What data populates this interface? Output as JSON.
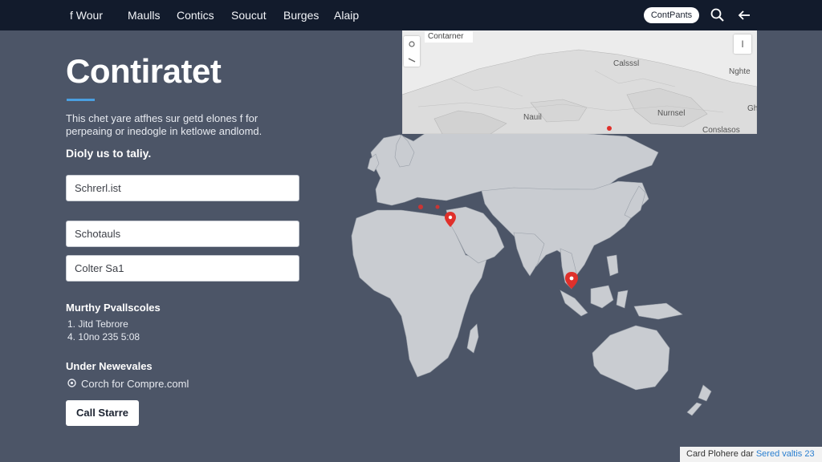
{
  "nav": {
    "items": [
      {
        "label": "f Wour"
      },
      {
        "label": "Maulls"
      },
      {
        "label": "Contics"
      },
      {
        "label": "Soucut"
      },
      {
        "label": "Burges"
      },
      {
        "label": "Alaip"
      }
    ],
    "pill_label": "ContPants",
    "icons": [
      "search-icon",
      "back-arrow-icon"
    ]
  },
  "hero": {
    "title": "Contiratet",
    "description": "This chet yare atfhes sur getd elones f for perpeaing or inedogle in ketlowe andlomd.",
    "subheading": "Dioly us to taliy."
  },
  "form": {
    "field1_placeholder": "Schrerl.ist",
    "field2_placeholder": "Schotauls",
    "field3_placeholder": "Colter Sa1"
  },
  "info": {
    "title": "Murthy Pvallscoles",
    "line1": "1. Jitd Tebrore",
    "line2": "4. 10no 235 5:08"
  },
  "network": {
    "title": "Under Newevales",
    "link_label": "Corch for Compre.coml",
    "icon": "globe-icon"
  },
  "cta": {
    "label": "Call Starre"
  },
  "inset_map": {
    "search_label": "Contarner",
    "labels": {
      "a": "Calsssl",
      "b": "Nghte",
      "c": "Nurnsel",
      "d": "Nauil",
      "e": "Conslasos",
      "f": "Ghil"
    },
    "zoom_label": "I"
  },
  "credit": {
    "prefix": "Card Plohere dar ",
    "link": "Sered valtis 23"
  },
  "colors": {
    "background": "#4c5567",
    "nav": "#121b2c",
    "land": "#c9ccd1",
    "marker": "#e0302b",
    "accent": "#4a9fe0"
  }
}
